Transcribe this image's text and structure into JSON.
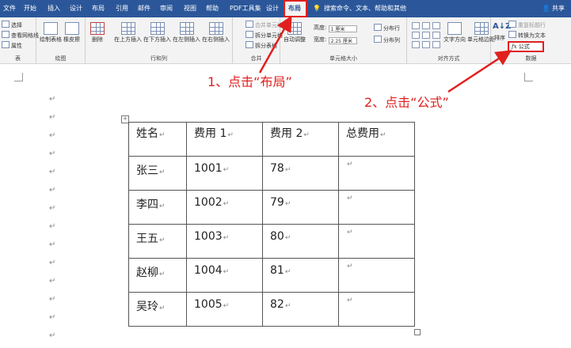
{
  "ribbon_tabs": [
    {
      "label": "文件"
    },
    {
      "label": "开始"
    },
    {
      "label": "插入"
    },
    {
      "label": "设计"
    },
    {
      "label": "布局"
    },
    {
      "label": "引用"
    },
    {
      "label": "邮件"
    },
    {
      "label": "审阅"
    },
    {
      "label": "视图"
    },
    {
      "label": "帮助"
    },
    {
      "label": "PDF工具集"
    },
    {
      "label": "设计"
    },
    {
      "label": "布局"
    }
  ],
  "active_tab_index": 12,
  "tell_me": "搜索命令、文本、帮助和其他",
  "share": "共享",
  "groups": {
    "table": {
      "label": "表",
      "items": [
        "选择",
        "查看网格线",
        "属性"
      ]
    },
    "draw": {
      "label": "绘图",
      "buttons": [
        "绘制表格",
        "橡皮擦"
      ]
    },
    "rows_cols": {
      "label": "行和列",
      "buttons": [
        "删除",
        "在上方插入",
        "在下方插入",
        "在左侧插入",
        "在右侧插入"
      ]
    },
    "merge": {
      "label": "合并",
      "items": [
        "合并单元格",
        "拆分单元格",
        "拆分表格"
      ]
    },
    "cell_size": {
      "label": "单元格大小",
      "autofit": "自动调整",
      "height_label": "高度:",
      "height_value": "1 厘米",
      "width_label": "宽度:",
      "width_value": "2.25 厘米",
      "distribute_rows": "分布行",
      "distribute_cols": "分布列"
    },
    "alignment": {
      "label": "对齐方式",
      "text_direction": "文字方向",
      "cell_margins": "单元格边距"
    },
    "data": {
      "label": "数据",
      "sort": "排序",
      "repeat_header": "重复标题行",
      "convert_text": "转换为文本",
      "formula": "公式"
    }
  },
  "annotations": {
    "step1": "1、点击“布局”",
    "step2": "2、点击“公式”"
  },
  "accent_color": "#e0201e",
  "ribbon_color": "#2b579a",
  "table": {
    "headers": [
      "姓名",
      "费用 1",
      "费用 2",
      "总费用"
    ],
    "rows": [
      [
        "张三",
        "1001",
        "78",
        ""
      ],
      [
        "李四",
        "1002",
        "79",
        ""
      ],
      [
        "王五",
        "1003",
        "80",
        ""
      ],
      [
        "赵柳",
        "1004",
        "81",
        ""
      ],
      [
        "吴玲",
        "1005",
        "82",
        ""
      ]
    ],
    "cell_mark": "↵"
  }
}
